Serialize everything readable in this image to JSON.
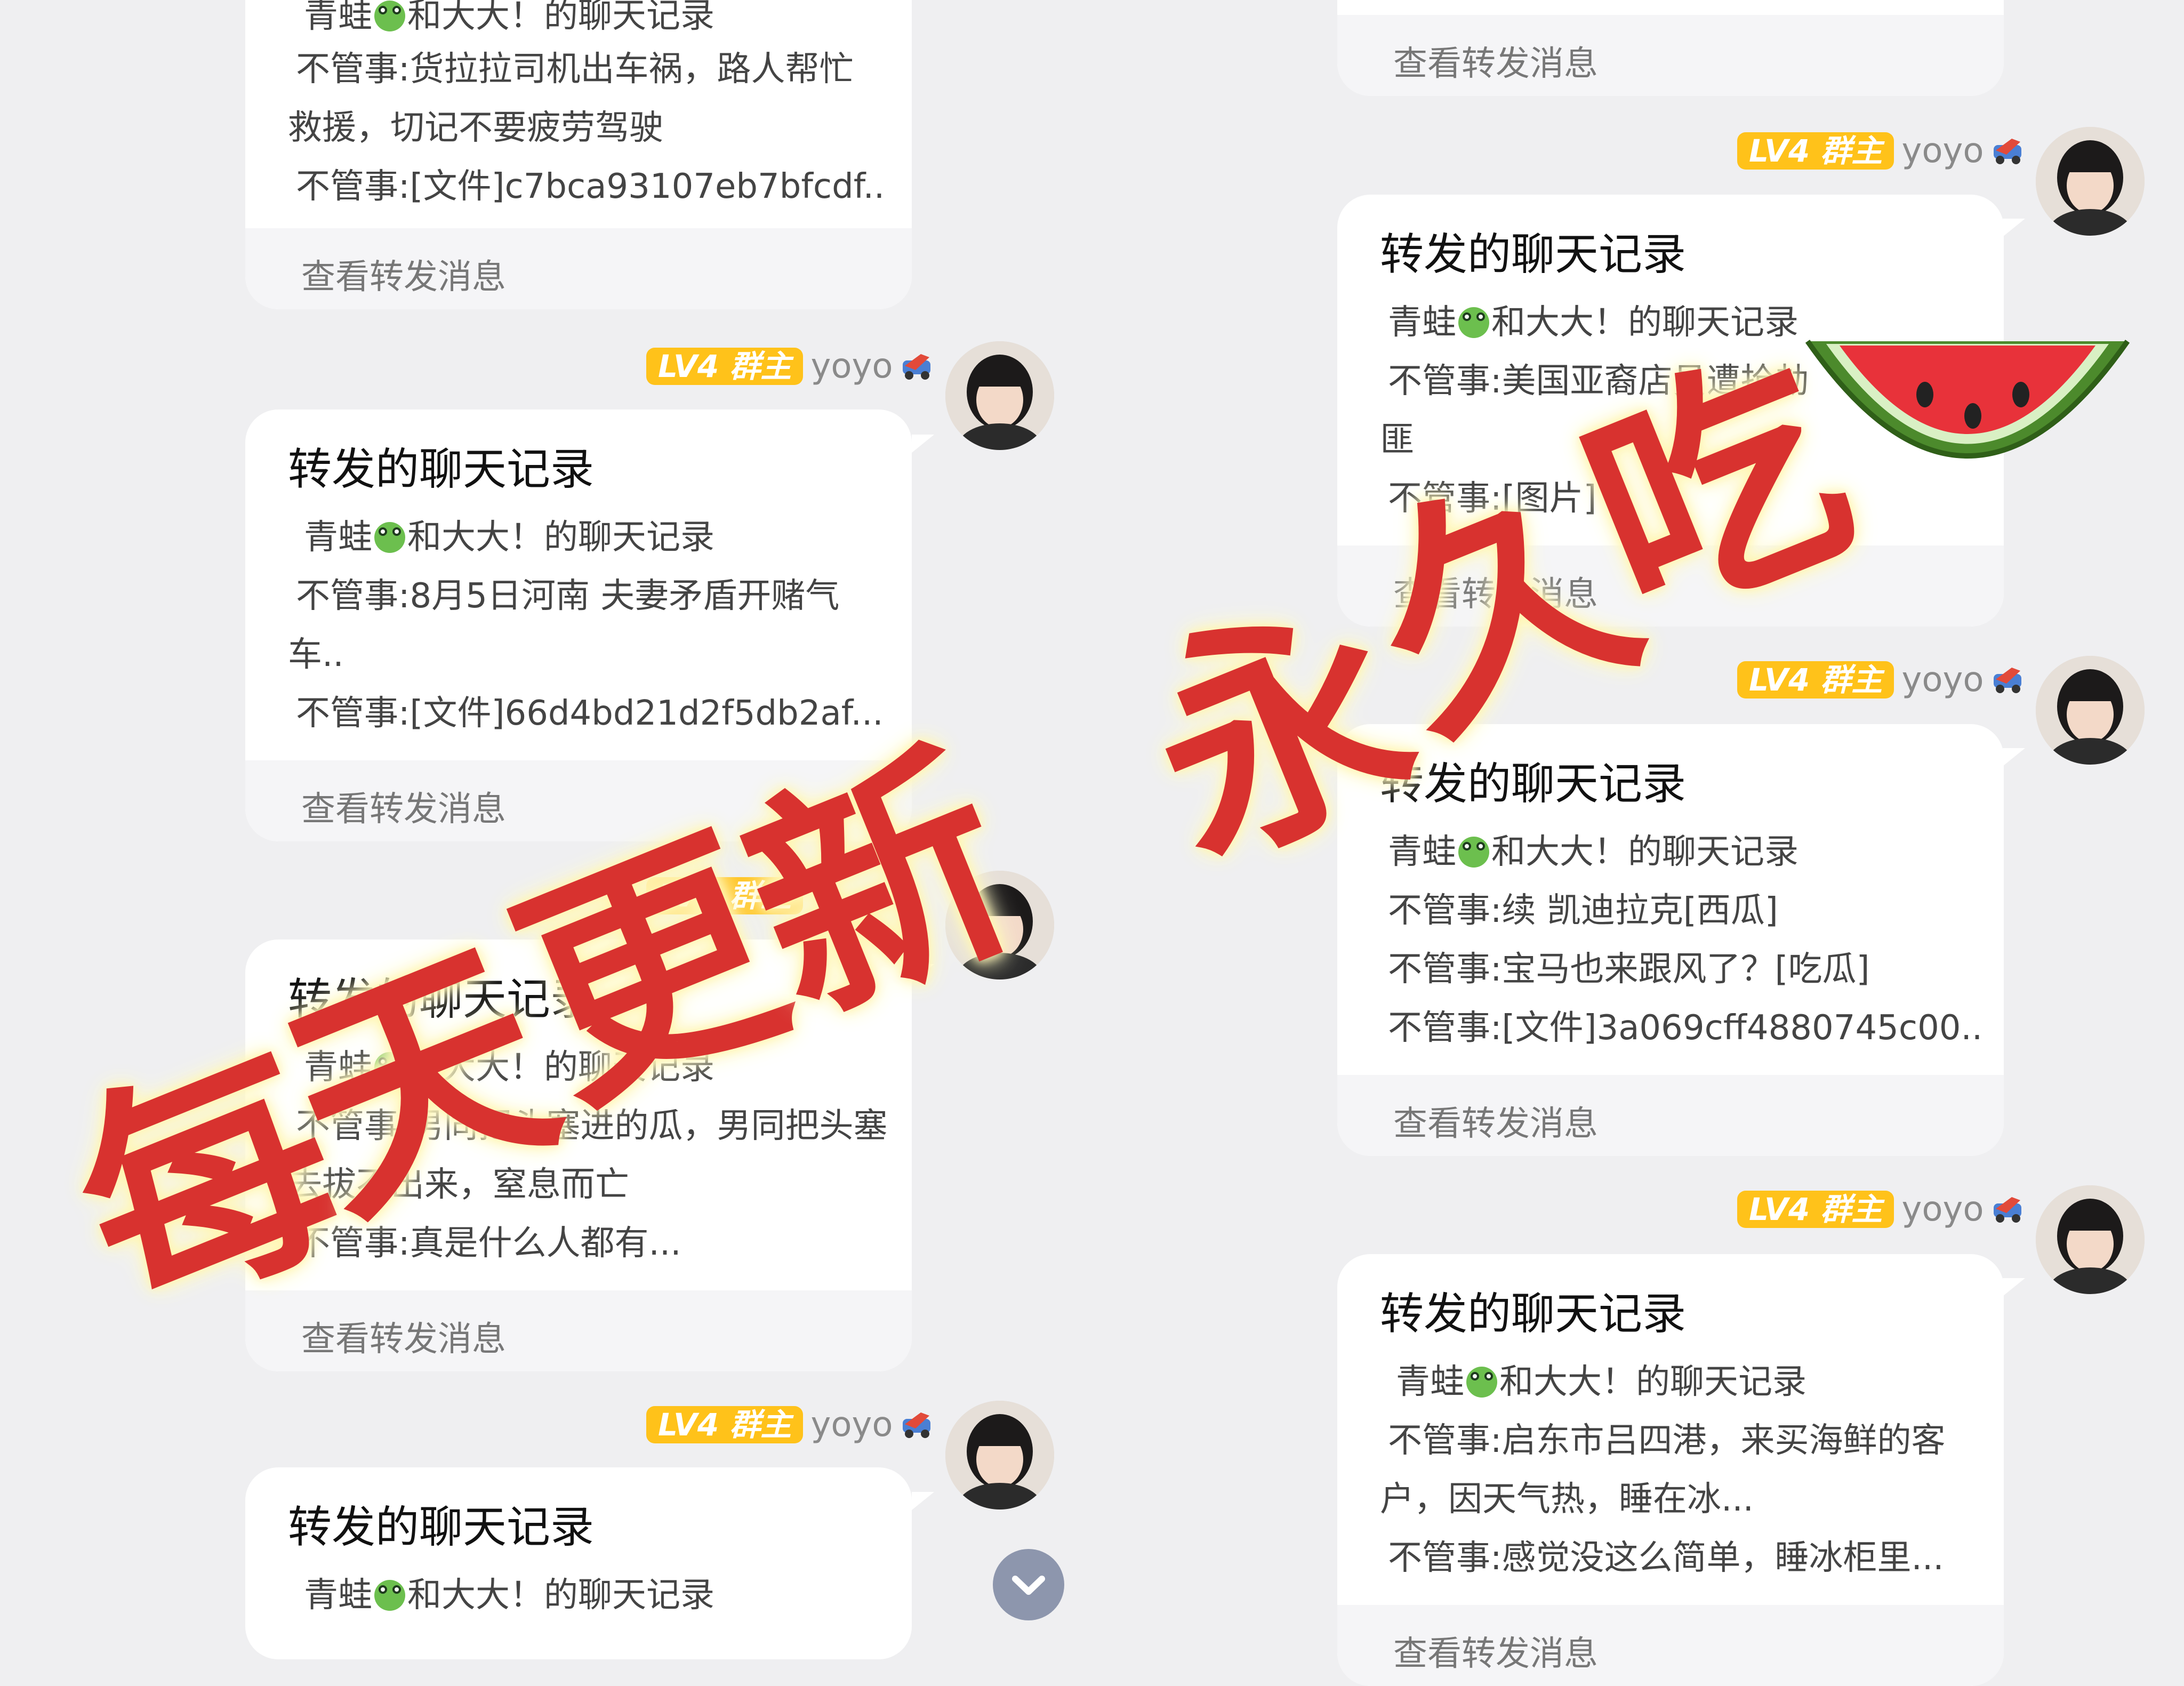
{
  "sender": {
    "level": "LV4",
    "role": "群主",
    "name": "yoyo"
  },
  "cards": [
    {
      "lines": [
        "青蛙[frog]和大大！的聊天记录",
        "不管事:货拉拉司机出车祸，路人帮忙",
        "救援，切记不要疲劳驾驶",
        "不管事:[文件]c7bca93107eb7bfcdf..."
      ],
      "footer": "查看转发消息"
    },
    {
      "title": "转发的聊天记录",
      "line1_a": "青蛙",
      "line1_b": "和大大！的聊天记录",
      "line2": "不管事:8月5日河南 夫妻矛盾开赌气",
      "line3": "车..",
      "line4": "不管事:[文件]66d4bd21d2f5db2af...",
      "footer": "查看转发消息"
    },
    {
      "title": "转发的聊天记录",
      "line1_a": "青蛙",
      "line1_b": "和大大！的聊天记录",
      "line2": "不管事:男同把头塞进的瓜，男同把头塞进",
      "line3": "去拔不出来，窒息而亡",
      "line4": "不管事:真是什么人都有...",
      "footer": "查看转发消息"
    },
    {
      "title": "转发的聊天记录",
      "line1_a": "青蛙",
      "line1_b": "和大大！的聊天记录"
    },
    {
      "footer": "查看转发消息"
    },
    {
      "title": "转发的聊天记录",
      "line1_a": "青蛙",
      "line1_b": "和大大！的聊天记录",
      "line2": "不管事:美国亚裔店员遭抢劫",
      "line3": "匪",
      "line4": "不管事:[图片]",
      "footer": "查看转发消息"
    },
    {
      "title": "转发的聊天记录",
      "line1_a": "青蛙",
      "line1_b": "和大大！的聊天记录",
      "line2": "不管事:续 凯迪拉克[西瓜]",
      "line3": "不管事:宝马也来跟风了？[吃瓜]",
      "line4": "不管事:[文件]3a069cff4880745c00...",
      "footer": "查看转发消息"
    },
    {
      "title": "转发的聊天记录",
      "line1_a": "青蛙",
      "line1_b": "和大大！的聊天记录",
      "line2": "不管事:启东市吕四港，来买海鲜的客",
      "line3": "户，因天气热，睡在冰...",
      "line4": "不管事:感觉没这么简单，睡冰柜里...",
      "footer": "查看转发消息"
    }
  ],
  "overlay": {
    "left_text": [
      "每",
      "天",
      "更",
      "新"
    ],
    "right_text": [
      "永",
      "久",
      "吃"
    ]
  },
  "colors": {
    "badge": "#ffc21a",
    "overlay_red": "#d8322f",
    "background": "#efeff1"
  },
  "icons": [
    "frog-emoji-icon",
    "sender-emoji-icon",
    "chevron-down-icon",
    "watermelon-icon"
  ]
}
